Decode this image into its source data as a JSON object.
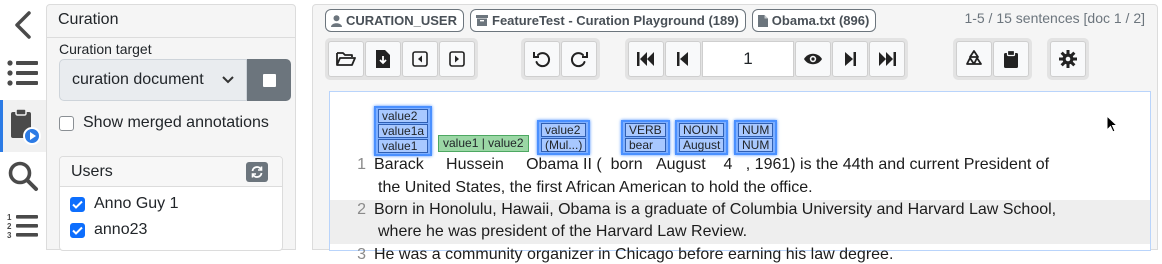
{
  "sidebar": {
    "title": "Curation",
    "target_label": "Curation target",
    "target_value": "curation document",
    "show_merged_label": "Show merged annotations",
    "users_header": "Users",
    "users": [
      {
        "name": "Anno Guy 1",
        "checked": true
      },
      {
        "name": "anno23",
        "checked": true
      }
    ]
  },
  "rail": {
    "icons": [
      "chevron-left-icon",
      "list-icon",
      "clipboard-play-icon",
      "search-icon",
      "numbered-list-icon"
    ]
  },
  "header": {
    "user_badge": "CURATION_USER",
    "project_badge": "FeatureTest - Curation Playground (189)",
    "document_badge": "Obama.txt (896)",
    "sentence_info": "1-5 / 15 sentences [doc 1 / 2]"
  },
  "toolbar": {
    "page_value": "1"
  },
  "annotations": {
    "barack": [
      "value2",
      "value1a",
      "value1"
    ],
    "hussein": "value1 | value2",
    "obama": [
      "value2",
      "(Mul...)"
    ],
    "born": [
      "VERB",
      "bear"
    ],
    "august": [
      "NOUN",
      "August"
    ],
    "four": [
      "NUM",
      "NUM"
    ]
  },
  "sentences": [
    {
      "number": "1",
      "tokens": [
        "Barack",
        "Hussein",
        "Obama",
        "II (",
        "born",
        "August",
        "4",
        ", 1961) is the 44th and current President of"
      ],
      "line2": "the   United States, the first African American to hold the office."
    },
    {
      "number": "2",
      "line1": "Born in Honolulu, Hawaii,   Obama is a graduate of Columbia University and Harvard Law School,",
      "line2": "where he was president of   the Harvard Law Review."
    },
    {
      "number": "3",
      "line1": "He was a community organizer in Chicago before earning his law degree."
    }
  ],
  "colors": {
    "accent": "#0d6efd",
    "annotation_blue": "#7fb0ff",
    "annotation_green": "#9bd7a5",
    "sidebar_bg": "#f5f5f5"
  }
}
